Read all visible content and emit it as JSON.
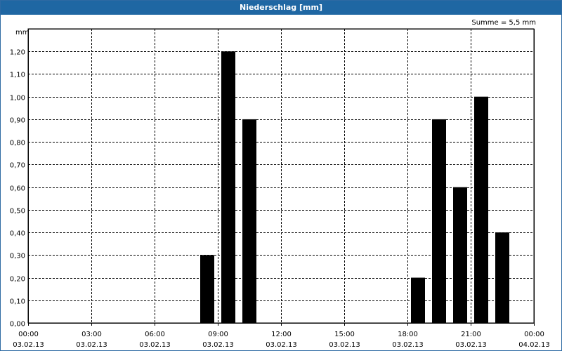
{
  "window": {
    "title": "Niederschlag [mm]"
  },
  "summary": {
    "text": "Summe = 5,5 mm"
  },
  "colors": {
    "titlebar": "#1f67a3",
    "bars": "#000000",
    "grid": "#000000"
  },
  "chart_data": {
    "type": "bar",
    "title": "Niederschlag [mm]",
    "ylabel": "mm",
    "xlabel": "",
    "ylim": [
      0,
      1.3
    ],
    "grid": true,
    "bar_color": "#000000",
    "y_ticks": [
      "0,00",
      "0,10",
      "0,20",
      "0,30",
      "0,40",
      "0,50",
      "0,60",
      "0,70",
      "0,80",
      "0,90",
      "1,00",
      "1,10",
      "1,20"
    ],
    "x_ticks": [
      {
        "time": "00:00",
        "date": "03.02.13"
      },
      {
        "time": "03:00",
        "date": "03.02.13"
      },
      {
        "time": "06:00",
        "date": "03.02.13"
      },
      {
        "time": "09:00",
        "date": "03.02.13"
      },
      {
        "time": "12:00",
        "date": "03.02.13"
      },
      {
        "time": "15:00",
        "date": "03.02.13"
      },
      {
        "time": "18:00",
        "date": "03.02.13"
      },
      {
        "time": "21:00",
        "date": "03.02.13"
      },
      {
        "time": "00:00",
        "date": "04.02.13"
      }
    ],
    "x_range_hours": [
      0,
      24
    ],
    "bars": [
      {
        "hour": 8.5,
        "value": 0.3
      },
      {
        "hour": 9.5,
        "value": 1.2
      },
      {
        "hour": 10.5,
        "value": 0.9
      },
      {
        "hour": 18.5,
        "value": 0.2
      },
      {
        "hour": 19.5,
        "value": 0.9
      },
      {
        "hour": 20.5,
        "value": 0.6
      },
      {
        "hour": 21.5,
        "value": 1.0
      },
      {
        "hour": 22.5,
        "value": 0.4
      }
    ]
  }
}
